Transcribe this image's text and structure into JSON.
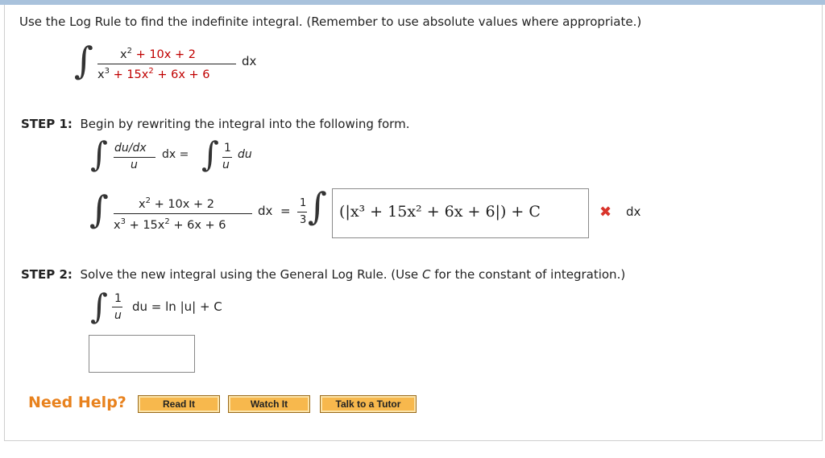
{
  "question": {
    "text": "Use the Log Rule to find the indefinite integral. (Remember to use absolute values where appropriate.)"
  },
  "main_integral": {
    "numerator_x": "x",
    "numerator_exp": "2",
    "numerator_rest": " + 10x + 2",
    "denominator_x": "x",
    "denominator_exp": "3",
    "denominator_mid": " + 15x",
    "denominator_exp2": "2",
    "denominator_rest": " + 6x + 6",
    "dx": "dx"
  },
  "step1": {
    "label": "STEP 1:",
    "text": "Begin by rewriting the integral into the following form.",
    "form_numerator": "du/dx",
    "form_denominator": "u",
    "form_dx": "dx",
    "form_equals": "=",
    "form_one": "1",
    "form_u": "u",
    "form_du": "du",
    "coef_num": "1",
    "coef_den": "3",
    "answer_expr": "(|x³ + 15x² + 6x + 6|) + C",
    "answer_status": "incorrect",
    "trailing_dx": "dx",
    "equals": "="
  },
  "step2": {
    "label": "STEP 2:",
    "text_before": "Solve the new integral using the General Log Rule. (Use ",
    "text_var": "C",
    "text_after": " for the constant of integration.)",
    "one": "1",
    "u": "u",
    "rhs": "du = ln |u| + C",
    "answer_value": ""
  },
  "help": {
    "label": "Need Help?",
    "buttons": [
      "Read It",
      "Watch It",
      "Talk to a Tutor"
    ]
  },
  "icons": {
    "incorrect": "x-mark-icon"
  },
  "colors": {
    "accent_red": "#c00000",
    "error_x": "#d9342b",
    "help_orange": "#e8821e",
    "button_fill": "#f7b84d"
  }
}
